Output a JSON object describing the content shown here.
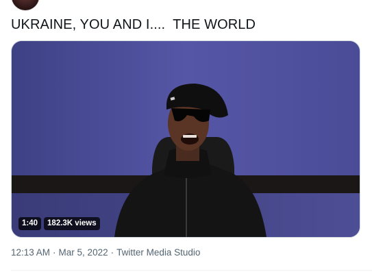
{
  "tweet": {
    "text": "UKRAINE, YOU AND I....  THE WORLD"
  },
  "media": {
    "duration": "1:40",
    "views": "182.3K views"
  },
  "meta": {
    "time": "12:13 AM",
    "date": "Mar 5, 2022",
    "source": "Twitter Media Studio"
  }
}
